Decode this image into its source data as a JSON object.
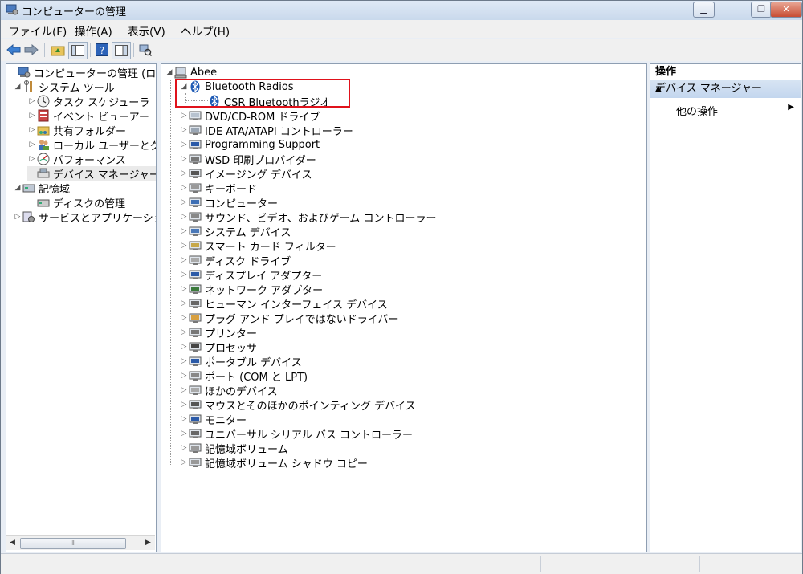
{
  "window": {
    "title": "コンピューターの管理",
    "caption_min": "▁",
    "caption_restore": "❐",
    "caption_close": "✕"
  },
  "menu": [
    {
      "label": "ファイル(F)"
    },
    {
      "label": "操作(A)"
    },
    {
      "label": "表示(V)"
    },
    {
      "label": "ヘルプ(H)"
    }
  ],
  "left_tree": [
    {
      "label": "コンピューターの管理 (ローカ",
      "expander": "",
      "icon": "computer-management-icon"
    },
    {
      "label": "システム ツール",
      "expander": "◢",
      "icon": "tools-icon"
    },
    {
      "label": "タスク スケジューラ",
      "expander": "▷",
      "icon": "clock-icon"
    },
    {
      "label": "イベント ビューアー",
      "expander": "▷",
      "icon": "event-viewer-icon"
    },
    {
      "label": "共有フォルダー",
      "expander": "▷",
      "icon": "shared-folder-icon"
    },
    {
      "label": "ローカル ユーザーとグル",
      "expander": "▷",
      "icon": "users-icon"
    },
    {
      "label": "パフォーマンス",
      "expander": "▷",
      "icon": "performance-icon"
    },
    {
      "label": "デバイス マネージャー",
      "expander": "",
      "icon": "device-manager-icon"
    },
    {
      "label": "記憶域",
      "expander": "◢",
      "icon": "storage-icon"
    },
    {
      "label": "ディスクの管理",
      "expander": "",
      "icon": "disk-management-icon"
    },
    {
      "label": "サービスとアプリケーション",
      "expander": "▷",
      "icon": "services-icon"
    }
  ],
  "hscroll": {
    "left": "◀",
    "right": "▶",
    "grip": "III"
  },
  "device_tree": {
    "root": {
      "label": "Abee",
      "expander": "◢",
      "icon": "computer-icon"
    },
    "bluetooth": {
      "label": "Bluetooth Radios",
      "expander": "◢",
      "icon": "bluetooth-icon"
    },
    "bluetooth_child": {
      "label": "CSR Bluetoothラジオ",
      "icon": "bluetooth-icon"
    },
    "categories": [
      {
        "label": "DVD/CD-ROM ドライブ",
        "icon": "dvd-drive-icon"
      },
      {
        "label": "IDE ATA/ATAPI コントローラー",
        "icon": "ide-controller-icon"
      },
      {
        "label": "Programming Support",
        "icon": "monitor-icon"
      },
      {
        "label": "WSD 印刷プロバイダー",
        "icon": "printer-icon"
      },
      {
        "label": "イメージング デバイス",
        "icon": "camera-icon"
      },
      {
        "label": "キーボード",
        "icon": "keyboard-icon"
      },
      {
        "label": "コンピューター",
        "icon": "computer-icon"
      },
      {
        "label": "サウンド、ビデオ、およびゲーム コントローラー",
        "icon": "speaker-icon"
      },
      {
        "label": "システム デバイス",
        "icon": "system-device-icon"
      },
      {
        "label": "スマート カード フィルター",
        "icon": "smart-card-icon"
      },
      {
        "label": "ディスク ドライブ",
        "icon": "disk-drive-icon"
      },
      {
        "label": "ディスプレイ アダプター",
        "icon": "display-adapter-icon"
      },
      {
        "label": "ネットワーク アダプター",
        "icon": "network-adapter-icon"
      },
      {
        "label": "ヒューマン インターフェイス デバイス",
        "icon": "hid-icon"
      },
      {
        "label": "プラグ アンド プレイではないドライバー",
        "icon": "driver-icon"
      },
      {
        "label": "プリンター",
        "icon": "printer-icon"
      },
      {
        "label": "プロセッサ",
        "icon": "processor-icon"
      },
      {
        "label": "ポータブル デバイス",
        "icon": "portable-device-icon"
      },
      {
        "label": "ポート (COM と LPT)",
        "icon": "port-icon"
      },
      {
        "label": "ほかのデバイス",
        "icon": "other-device-icon"
      },
      {
        "label": "マウスとそのほかのポインティング デバイス",
        "icon": "mouse-icon"
      },
      {
        "label": "モニター",
        "icon": "monitor-icon"
      },
      {
        "label": "ユニバーサル シリアル バス コントローラー",
        "icon": "usb-icon"
      },
      {
        "label": "記憶域ボリューム",
        "icon": "volume-icon"
      },
      {
        "label": "記憶域ボリューム シャドウ コピー",
        "icon": "volume-icon"
      }
    ],
    "collapsed_marker": "▷"
  },
  "actions": {
    "header": "操作",
    "selected": "デバイス マネージャー",
    "collapse_arrow": "▲",
    "more": "他の操作",
    "more_arrow": "▶"
  },
  "colors": {
    "highlight_border": "#e0121b",
    "selection_band": "#c3d6ee"
  }
}
